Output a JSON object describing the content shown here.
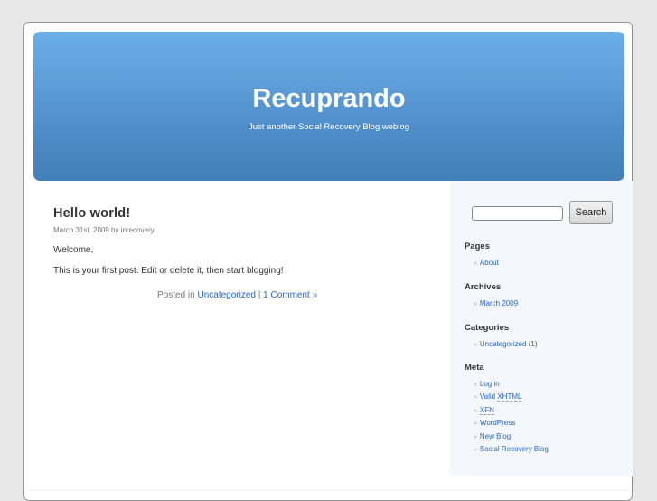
{
  "header": {
    "title": "Recuprando",
    "description": "Just another Social Recovery Blog weblog"
  },
  "post": {
    "title": "Hello world!",
    "meta": "March 31st, 2009 by inrecovery",
    "paragraphs": [
      "Welcome,",
      "This is your first post. Edit or delete it, then start blogging!"
    ],
    "posted_in_label": "Posted in",
    "category": "Uncategorized",
    "separator": "|",
    "comments": "1 Comment »"
  },
  "sidebar": {
    "search": {
      "value": "",
      "button": "Search"
    },
    "bullet": "»",
    "pages": {
      "title": "Pages",
      "items": [
        "About"
      ]
    },
    "archives": {
      "title": "Archives",
      "items": [
        "March 2009"
      ]
    },
    "categories": {
      "title": "Categories",
      "items": [
        {
          "label": "Uncategorized",
          "count": "(1)"
        }
      ]
    },
    "meta": {
      "title": "Meta",
      "items": [
        "Log in",
        "Valid",
        "XHTML",
        "XFN",
        "WordPress",
        "New Blog",
        "Social Recovery Blog"
      ]
    }
  }
}
